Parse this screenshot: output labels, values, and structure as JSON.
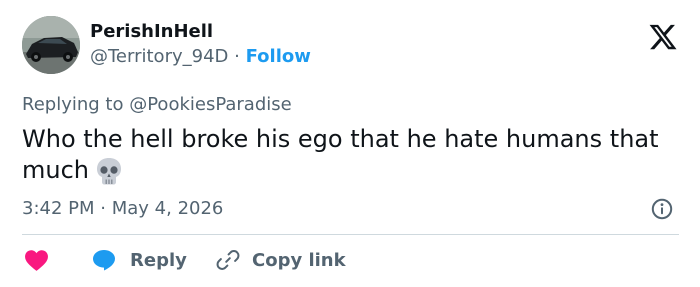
{
  "tweet": {
    "author": {
      "display_name": "PerishInHell",
      "handle": "@Territory_94D",
      "separator": "·",
      "follow_label": "Follow"
    },
    "brand_icon": "x-logo-icon",
    "reply_prefix": "Replying to",
    "reply_handle": "@PookiesParadise",
    "text": "Who the hell broke his ego that he hate humans that much",
    "emoji": "skull-icon",
    "time": "3:42 PM",
    "meta_separator": "·",
    "date": "May 4, 2026",
    "info_icon": "info-icon",
    "actions": {
      "like_icon": "heart-icon",
      "reply_label": "Reply",
      "reply_icon": "speech-bubble-icon",
      "copy_label": "Copy link",
      "copy_icon": "link-icon"
    }
  },
  "colors": {
    "accent": "#1d9bf0",
    "like": "#f91880",
    "text_primary": "#0f1419",
    "text_secondary": "#536471",
    "divider": "#cfd9de"
  }
}
